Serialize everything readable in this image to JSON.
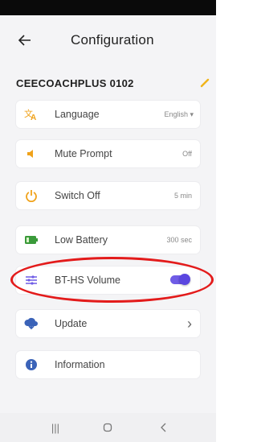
{
  "header": {
    "title": "Configuration"
  },
  "device": {
    "name": "CEECOACHPLUS 0102"
  },
  "settings": [
    {
      "label": "Language",
      "value": "English",
      "icon": "language-icon"
    },
    {
      "label": "Mute Prompt",
      "value": "Off",
      "icon": "speaker-icon"
    },
    {
      "label": "Switch Off",
      "value": "5 min",
      "icon": "power-icon"
    },
    {
      "label": "Low Battery",
      "value": "300 sec",
      "icon": "battery-icon"
    },
    {
      "label": "BT-HS Volume",
      "value": "on",
      "icon": "equalizer-icon"
    },
    {
      "label": "Update",
      "icon": "cloud-download-icon"
    },
    {
      "label": "Information",
      "icon": "info-icon"
    }
  ],
  "colors": {
    "accent": "#6f5ce6",
    "highlight": "#e31b1b",
    "icon_orange": "#f0a21a",
    "icon_blue": "#3b63b8"
  }
}
